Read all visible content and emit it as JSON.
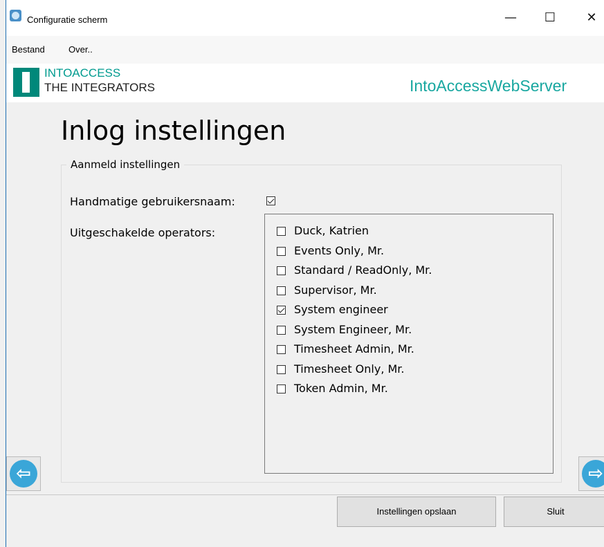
{
  "window": {
    "title": "Configuratie scherm",
    "minimize": "—",
    "maximize": "☐",
    "close": "✕"
  },
  "menu": {
    "items": [
      "Bestand",
      "Over.."
    ]
  },
  "banner": {
    "logo_line1": "INTOACCESS",
    "logo_line2": "THE INTEGRATORS",
    "server_name": "IntoAccessWebServer"
  },
  "page": {
    "title": "Inlog instellingen"
  },
  "group": {
    "legend": "Aanmeld instellingen",
    "manual_username_label": "Handmatige gebruikersnaam:",
    "manual_username_checked": true,
    "disabled_operators_label": "Uitgeschakelde operators:",
    "operators": [
      {
        "name": "Duck, Katrien",
        "checked": false
      },
      {
        "name": "Events Only, Mr.",
        "checked": false
      },
      {
        "name": "Standard / ReadOnly, Mr.",
        "checked": false
      },
      {
        "name": "Supervisor, Mr.",
        "checked": false
      },
      {
        "name": "System engineer",
        "checked": true
      },
      {
        "name": "System Engineer, Mr.",
        "checked": false
      },
      {
        "name": "Timesheet Admin, Mr.",
        "checked": false
      },
      {
        "name": "Timesheet Only, Mr.",
        "checked": false
      },
      {
        "name": "Token Admin, Mr.",
        "checked": false
      }
    ]
  },
  "footer": {
    "save_label": "Instellingen opslaan",
    "close_label": "Sluit"
  },
  "icons": {
    "back": "arrow-left-icon",
    "forward": "arrow-right-icon"
  }
}
